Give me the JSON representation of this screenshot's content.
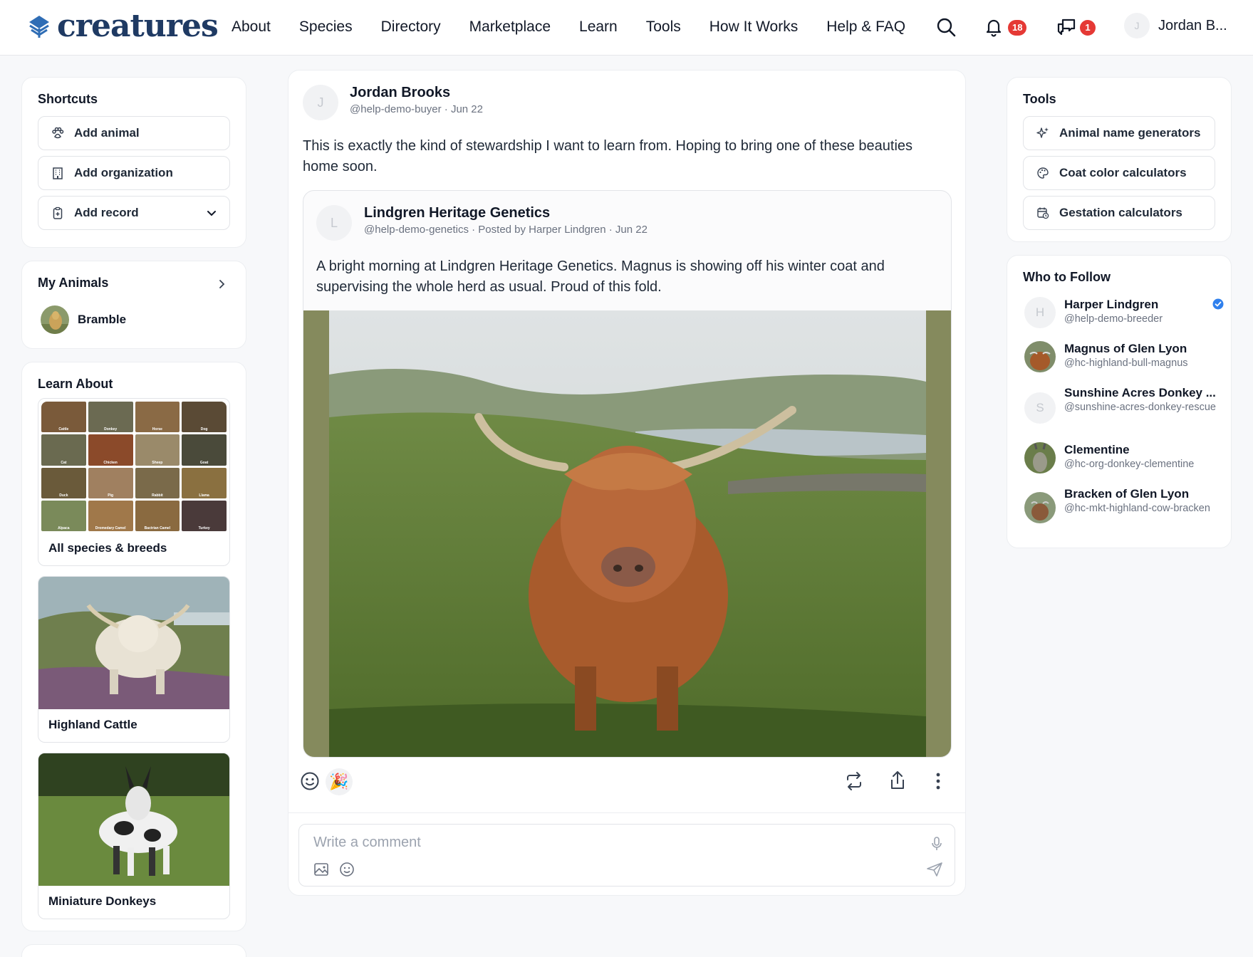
{
  "app": {
    "logo_text": "creatures",
    "nav": [
      "About",
      "Species",
      "Directory",
      "Marketplace",
      "Learn",
      "Tools",
      "How It Works",
      "Help & FAQ"
    ],
    "notifications_count": "18",
    "messages_count": "1",
    "user_initial": "J",
    "user_name": "Jordan B..."
  },
  "shortcuts": {
    "title": "Shortcuts",
    "items": [
      {
        "label": "Add animal",
        "icon": "paw-icon"
      },
      {
        "label": "Add organization",
        "icon": "building-icon"
      },
      {
        "label": "Add record",
        "icon": "clipboard-icon"
      }
    ]
  },
  "my_animals": {
    "title": "My Animals",
    "items": [
      {
        "name": "Bramble"
      }
    ]
  },
  "learn_about": {
    "title": "Learn About",
    "species": [
      "Cattle",
      "Donkey",
      "Horse",
      "Dog",
      "Cat",
      "Chicken",
      "Sheep",
      "Goat",
      "Duck",
      "Pig",
      "Rabbit",
      "Llama",
      "Alpaca",
      "Dromedary Camel",
      "Bactrian Camel",
      "Turkey"
    ],
    "all_label": "All species & breeds",
    "cards": [
      {
        "label": "Highland Cattle"
      },
      {
        "label": "Miniature Donkeys"
      }
    ]
  },
  "post": {
    "author_initial": "J",
    "author": "Jordan Brooks",
    "meta": "@help-demo-buyer · Jun 22",
    "text": "This is exactly the kind of stewardship I want to learn from. Hoping to bring one of these beauties home soon.",
    "shared": {
      "initial": "L",
      "author": "Lindgren Heritage Genetics",
      "meta": "@help-demo-genetics · Posted by Harper Lindgren · Jun 22",
      "text": "A bright morning at Lindgren Heritage Genetics. Magnus is showing off his winter coat and supervising the whole herd as usual. Proud of this fold."
    },
    "reaction_emoji": "🎉",
    "comment_placeholder": "Write a comment"
  },
  "tools": {
    "title": "Tools",
    "items": [
      {
        "label": "Animal name generators",
        "icon": "sparkles-icon"
      },
      {
        "label": "Coat color calculators",
        "icon": "palette-icon"
      },
      {
        "label": "Gestation calculators",
        "icon": "calendar-icon"
      }
    ]
  },
  "who_to_follow": {
    "title": "Who to Follow",
    "items": [
      {
        "initial": "H",
        "name": "Harper Lindgren",
        "handle": "@help-demo-breeder",
        "verified": true
      },
      {
        "initial": "",
        "name": "Magnus of Glen Lyon",
        "handle": "@hc-highland-bull-magnus"
      },
      {
        "initial": "S",
        "name": "Sunshine Acres Donkey ...",
        "handle": "@sunshine-acres-donkey-rescue"
      },
      {
        "initial": "",
        "name": "Clementine",
        "handle": "@hc-org-donkey-clementine"
      },
      {
        "initial": "",
        "name": "Bracken of Glen Lyon",
        "handle": "@hc-mkt-highland-cow-bracken"
      }
    ]
  },
  "colors": {
    "brand": "#1f3a63",
    "badge": "#e53935",
    "verified": "#2f80ed"
  }
}
